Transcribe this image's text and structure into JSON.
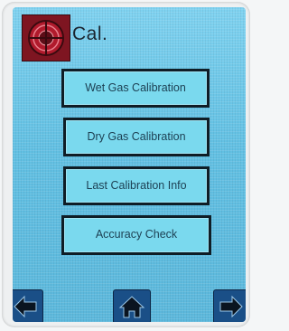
{
  "header": {
    "title": "Cal.",
    "logo_icon": "company-logo-icon"
  },
  "menu": {
    "items": [
      {
        "label": "Wet Gas Calibration"
      },
      {
        "label": "Dry Gas Calibration"
      },
      {
        "label": "Last Calibration Info"
      },
      {
        "label": "Accuracy Check"
      }
    ]
  },
  "nav": {
    "back_icon": "arrow-left-icon",
    "home_icon": "home-icon",
    "forward_icon": "arrow-right-icon"
  },
  "colors": {
    "screen_background": "#68c3e4",
    "button_fill": "#7ad9ee",
    "button_border": "#0f1d26",
    "nav_button": "#1a4f87",
    "logo_background": "#7e1521"
  }
}
